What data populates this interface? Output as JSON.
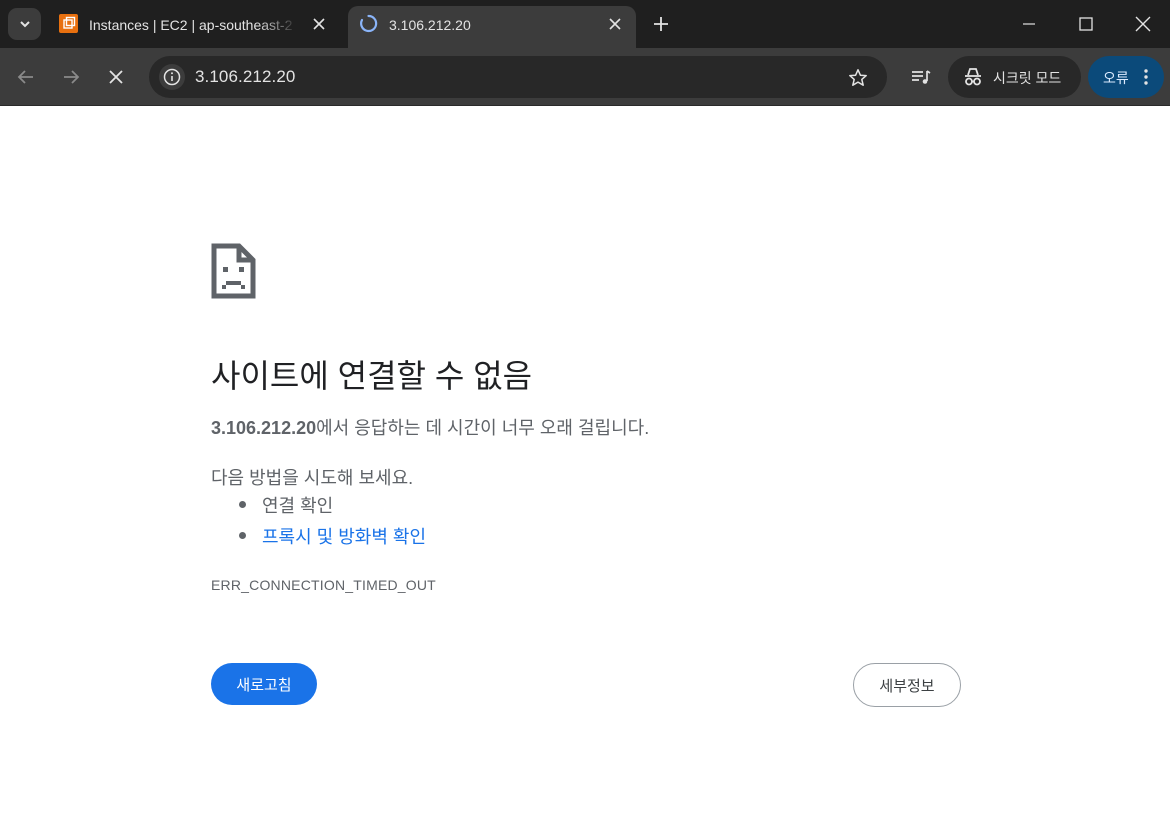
{
  "tabs": [
    {
      "title": "Instances | EC2 | ap-southeast-2",
      "active": false,
      "favicon": "aws-ec2-icon"
    },
    {
      "title": "3.106.212.20",
      "active": true,
      "favicon": "loading-spinner-icon"
    }
  ],
  "toolbar": {
    "url": "3.106.212.20",
    "incognito_label": "시크릿 모드",
    "error_label": "오류"
  },
  "error_page": {
    "heading": "사이트에 연결할 수 없음",
    "host": "3.106.212.20",
    "description": "에서 응답하는 데 시간이 너무 오래 걸립니다.",
    "suggestions_intro": "다음 방법을 시도해 보세요.",
    "suggestions": [
      {
        "text": "연결 확인",
        "link": false
      },
      {
        "text": "프록시 및 방화벽 확인",
        "link": true
      }
    ],
    "error_code": "ERR_CONNECTION_TIMED_OUT",
    "reload_button": "새로고침",
    "details_button": "세부정보"
  },
  "colors": {
    "tabstrip_bg": "#1f1f1f",
    "toolbar_bg": "#3c3c3c",
    "primary_button": "#1a73e8",
    "link": "#1a73e8",
    "error_chip_bg": "#0b4a7a"
  }
}
